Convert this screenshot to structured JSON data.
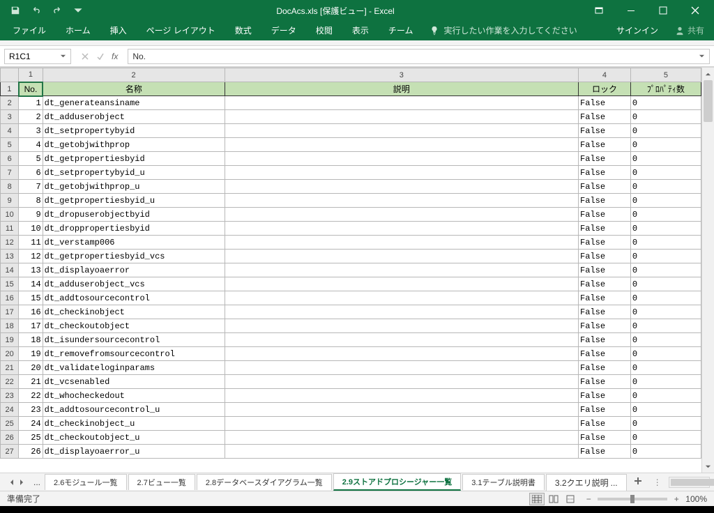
{
  "title": "DocAcs.xls  [保護ビュー] - Excel",
  "ribbon": {
    "file": "ファイル",
    "home": "ホーム",
    "insert": "挿入",
    "pagelayout": "ページ レイアウト",
    "formulas": "数式",
    "data": "データ",
    "review": "校閲",
    "view": "表示",
    "team": "チーム",
    "tellme": "実行したい作業を入力してください",
    "signin": "サインイン",
    "share": "共有"
  },
  "namebox": "R1C1",
  "formula": "No.",
  "col_nums": [
    "1",
    "2",
    "3",
    "4",
    "5"
  ],
  "headers": {
    "c1": "No.",
    "c2": "名称",
    "c3": "説明",
    "c4": "ロック",
    "c5": "ﾌﾟﾛﾊﾟﾃｨ数"
  },
  "rows": [
    {
      "n": "1",
      "name": "dt_generateansiname",
      "lock": "False",
      "prop": "0"
    },
    {
      "n": "2",
      "name": "dt_adduserobject",
      "lock": "False",
      "prop": "0"
    },
    {
      "n": "3",
      "name": "dt_setpropertybyid",
      "lock": "False",
      "prop": "0"
    },
    {
      "n": "4",
      "name": "dt_getobjwithprop",
      "lock": "False",
      "prop": "0"
    },
    {
      "n": "5",
      "name": "dt_getpropertiesbyid",
      "lock": "False",
      "prop": "0"
    },
    {
      "n": "6",
      "name": "dt_setpropertybyid_u",
      "lock": "False",
      "prop": "0"
    },
    {
      "n": "7",
      "name": "dt_getobjwithprop_u",
      "lock": "False",
      "prop": "0"
    },
    {
      "n": "8",
      "name": "dt_getpropertiesbyid_u",
      "lock": "False",
      "prop": "0"
    },
    {
      "n": "9",
      "name": "dt_dropuserobjectbyid",
      "lock": "False",
      "prop": "0"
    },
    {
      "n": "10",
      "name": "dt_droppropertiesbyid",
      "lock": "False",
      "prop": "0"
    },
    {
      "n": "11",
      "name": "dt_verstamp006",
      "lock": "False",
      "prop": "0"
    },
    {
      "n": "12",
      "name": "dt_getpropertiesbyid_vcs",
      "lock": "False",
      "prop": "0"
    },
    {
      "n": "13",
      "name": "dt_displayoaerror",
      "lock": "False",
      "prop": "0"
    },
    {
      "n": "14",
      "name": "dt_adduserobject_vcs",
      "lock": "False",
      "prop": "0"
    },
    {
      "n": "15",
      "name": "dt_addtosourcecontrol",
      "lock": "False",
      "prop": "0"
    },
    {
      "n": "16",
      "name": "dt_checkinobject",
      "lock": "False",
      "prop": "0"
    },
    {
      "n": "17",
      "name": "dt_checkoutobject",
      "lock": "False",
      "prop": "0"
    },
    {
      "n": "18",
      "name": "dt_isundersourcecontrol",
      "lock": "False",
      "prop": "0"
    },
    {
      "n": "19",
      "name": "dt_removefromsourcecontrol",
      "lock": "False",
      "prop": "0"
    },
    {
      "n": "20",
      "name": "dt_validateloginparams",
      "lock": "False",
      "prop": "0"
    },
    {
      "n": "21",
      "name": "dt_vcsenabled",
      "lock": "False",
      "prop": "0"
    },
    {
      "n": "22",
      "name": "dt_whocheckedout",
      "lock": "False",
      "prop": "0"
    },
    {
      "n": "23",
      "name": "dt_addtosourcecontrol_u",
      "lock": "False",
      "prop": "0"
    },
    {
      "n": "24",
      "name": "dt_checkinobject_u",
      "lock": "False",
      "prop": "0"
    },
    {
      "n": "25",
      "name": "dt_checkoutobject_u",
      "lock": "False",
      "prop": "0"
    },
    {
      "n": "26",
      "name": "dt_displayoaerror_u",
      "lock": "False",
      "prop": "0"
    }
  ],
  "sheet_tabs": {
    "t1": "2.6モジュール一覧",
    "t2": "2.7ビュー一覧",
    "t3": "2.8データベースダイアグラム一覧",
    "t4": "2.9ストアドプロシージャー一覧",
    "t5": "3.1テーブル説明書",
    "t6": "3.2クエリ説明"
  },
  "status": {
    "ready": "準備完了",
    "zoom": "100%"
  },
  "ellipsis": "..."
}
